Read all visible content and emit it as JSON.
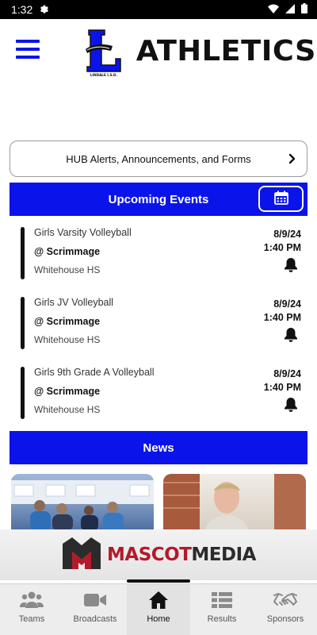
{
  "status_bar": {
    "time": "1:32"
  },
  "header": {
    "title": "ATHLETICS",
    "logo_text": "LINDALE I.S.D."
  },
  "hub_alerts": {
    "label": "HUB Alerts, Announcements, and Forms"
  },
  "upcoming": {
    "title": "Upcoming Events",
    "events": [
      {
        "name": "Girls Varsity Volleyball",
        "type": "@ Scrimmage",
        "location": "Whitehouse HS",
        "date": "8/9/24",
        "time": "1:40 PM"
      },
      {
        "name": "Girls JV Volleyball",
        "type": "@ Scrimmage",
        "location": "Whitehouse HS",
        "date": "8/9/24",
        "time": "1:40 PM"
      },
      {
        "name": "Girls 9th Grade A Volleyball",
        "type": "@ Scrimmage",
        "location": "Whitehouse HS",
        "date": "8/9/24",
        "time": "1:40 PM"
      }
    ]
  },
  "news": {
    "title": "News"
  },
  "sponsor": {
    "part1": "MASCOT",
    "part2": "MEDIA"
  },
  "nav": {
    "items": [
      {
        "label": "Teams",
        "icon": "teams-icon"
      },
      {
        "label": "Broadcasts",
        "icon": "video-camera-icon"
      },
      {
        "label": "Home",
        "icon": "home-icon",
        "active": true
      },
      {
        "label": "Results",
        "icon": "results-list-icon"
      },
      {
        "label": "Sponsors",
        "icon": "handshake-icon"
      }
    ]
  },
  "colors": {
    "accent": "#0a14ea",
    "text": "#111111",
    "brand_red": "#b3192a"
  }
}
